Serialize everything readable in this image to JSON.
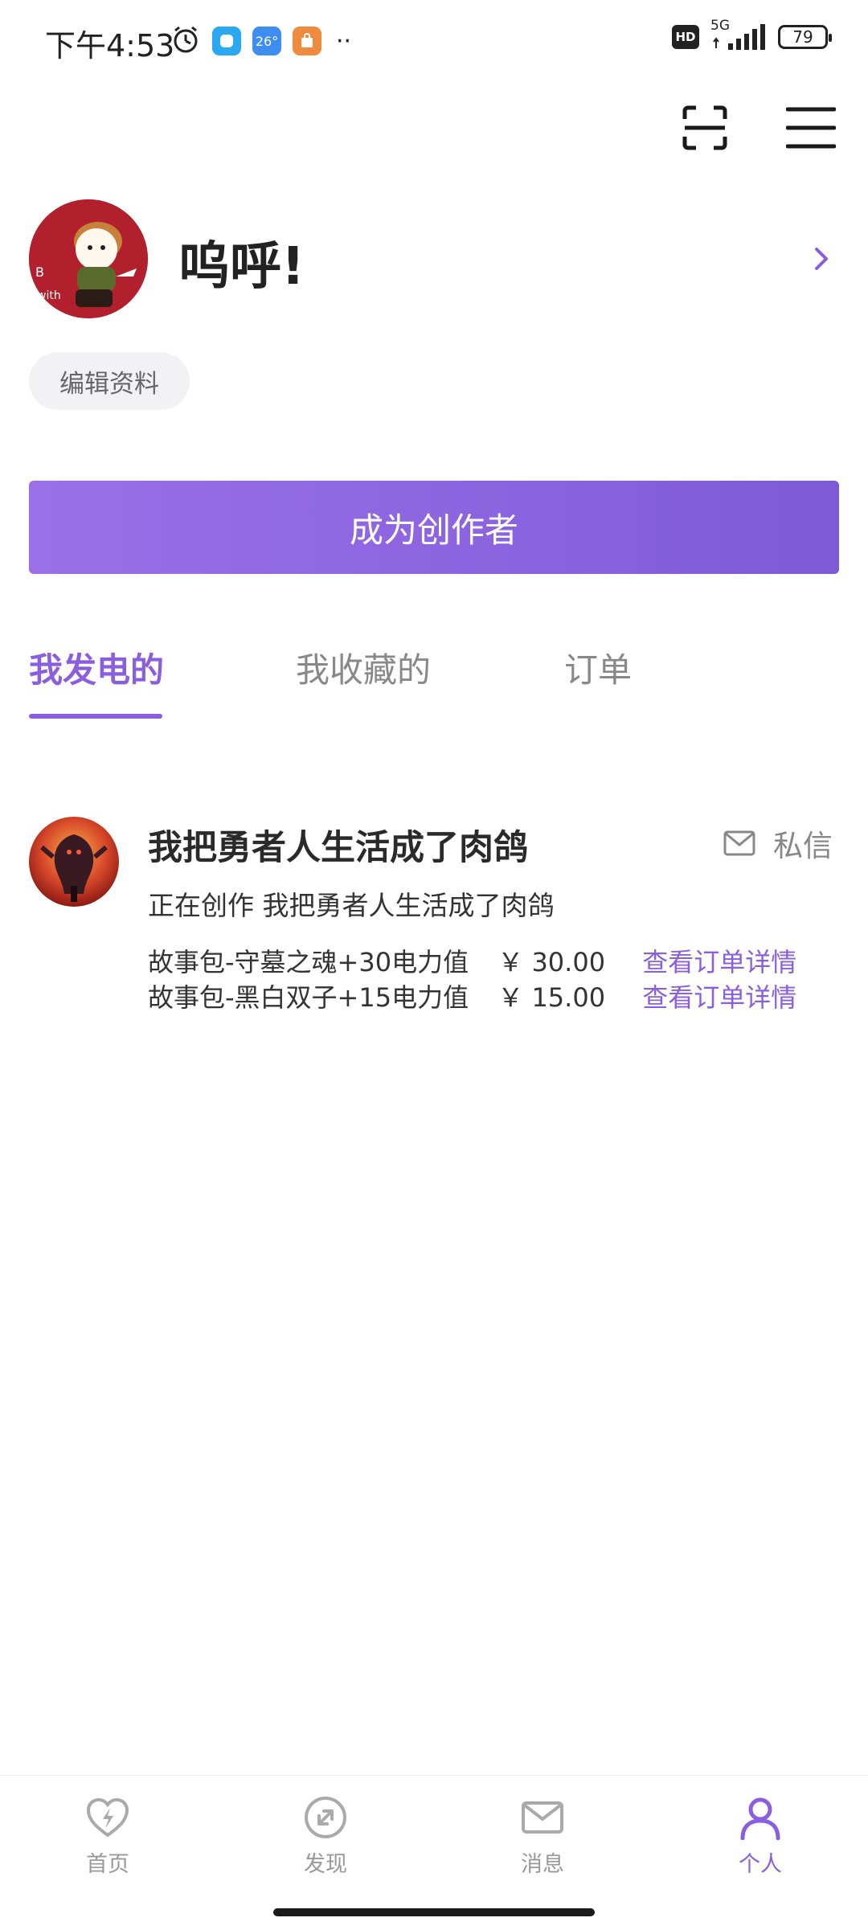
{
  "status_bar": {
    "time": "下午4:53",
    "weather_temp": "26°",
    "network": "5G",
    "hd": "HD",
    "battery": "79"
  },
  "profile": {
    "username": "呜呼!",
    "edit_label": "编辑资料"
  },
  "creator_button": "成为创作者",
  "tabs": [
    {
      "label": "我发电的",
      "active": true
    },
    {
      "label": "我收藏的",
      "active": false
    },
    {
      "label": "订单",
      "active": false
    }
  ],
  "orders": [
    {
      "title": "我把勇者人生活成了肉鸽",
      "dm_label": "私信",
      "subtitle": "正在创作 我把勇者人生活成了肉鸽",
      "lines": [
        {
          "item": "故事包-守墓之魂+30电力值",
          "price": "￥ 30.00",
          "link": "查看订单详情"
        },
        {
          "item": "故事包-黑白双子+15电力值",
          "price": "￥ 15.00",
          "link": "查看订单详情"
        }
      ]
    }
  ],
  "bottom_nav": [
    {
      "label": "首页",
      "icon": "lightning-heart-icon",
      "active": false
    },
    {
      "label": "发现",
      "icon": "compass-icon",
      "active": false
    },
    {
      "label": "消息",
      "icon": "mail-icon",
      "active": false
    },
    {
      "label": "个人",
      "icon": "person-icon",
      "active": true
    }
  ],
  "colors": {
    "accent": "#8a5fdf",
    "text_primary": "#222222",
    "text_secondary": "#888888"
  }
}
